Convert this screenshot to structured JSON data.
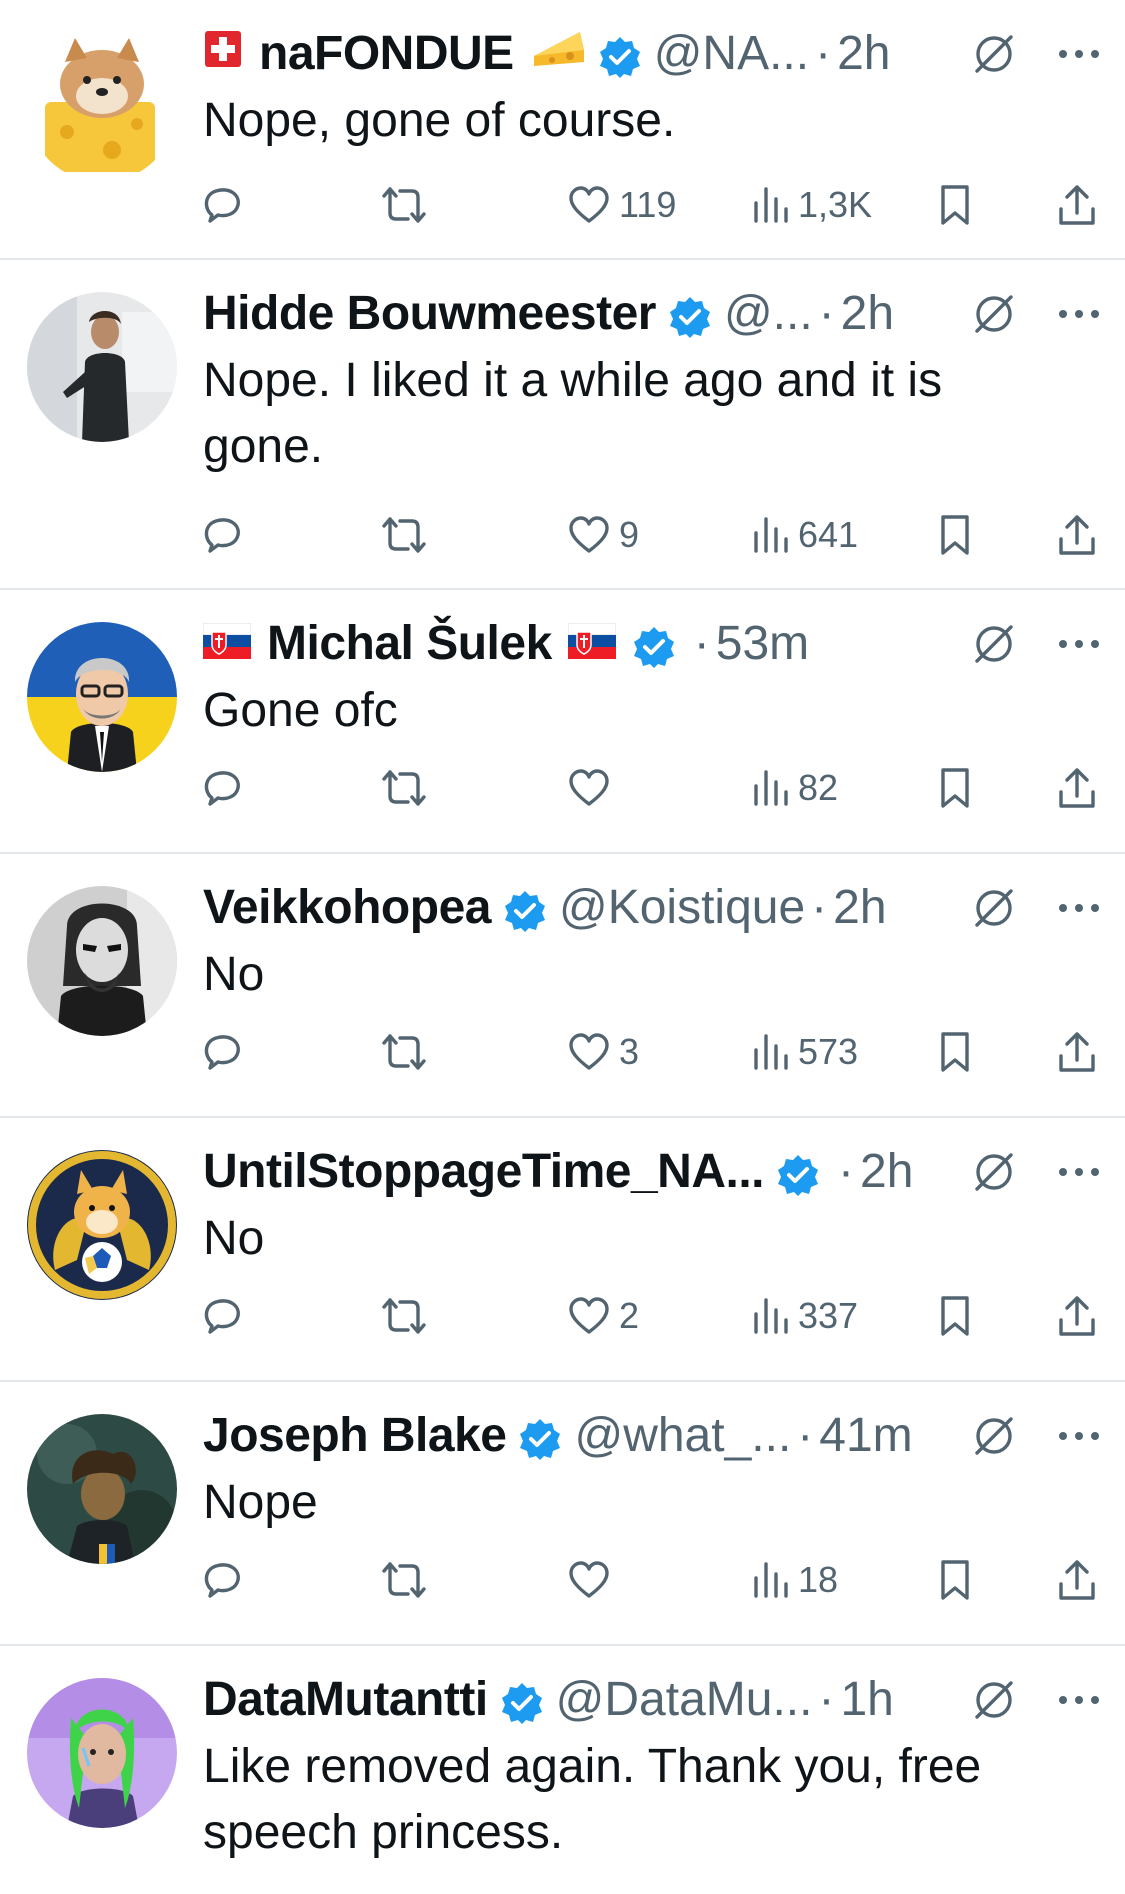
{
  "colors": {
    "text": "#0f1419",
    "secondary": "#536471",
    "verified": "#1d9bf0",
    "divider": "#e3e7ea"
  },
  "tweets": [
    {
      "name": "naFONDUE",
      "flag_before": "swiss-flag-icon",
      "emoji_after": "cheese-icon",
      "handle": "@NA...",
      "time": "2h",
      "text": "Nope, gone of course.",
      "likes": "119",
      "views": "1,3K"
    },
    {
      "name": "Hidde Bouwmeester",
      "handle": "@...",
      "time": "2h",
      "text": "Nope. I liked it a while ago and it is\ngone.",
      "likes": "9",
      "views": "641"
    },
    {
      "name": "Michal Šulek",
      "flag_before": "slovak-flag-icon",
      "flag_after": "slovak-flag-icon",
      "handle": "",
      "time": "53m",
      "text": "Gone ofc",
      "likes": "",
      "views": "82"
    },
    {
      "name": "Veikkohopea",
      "handle": "@Koistique",
      "time": "2h",
      "text": "No",
      "likes": "3",
      "views": "573"
    },
    {
      "name": "UntilStoppageTime_NA...",
      "handle": "",
      "time": "2h",
      "text": "No",
      "likes": "2",
      "views": "337"
    },
    {
      "name": "Joseph Blake",
      "handle": "@what_...",
      "time": "41m",
      "text": "Nope",
      "likes": "",
      "views": "18"
    },
    {
      "name": "DataMutantti",
      "handle": "@DataMu...",
      "time": "1h",
      "text": "Like removed again. Thank you, free\nspeech princess.",
      "likes": "",
      "views": ""
    }
  ],
  "separator": "·"
}
